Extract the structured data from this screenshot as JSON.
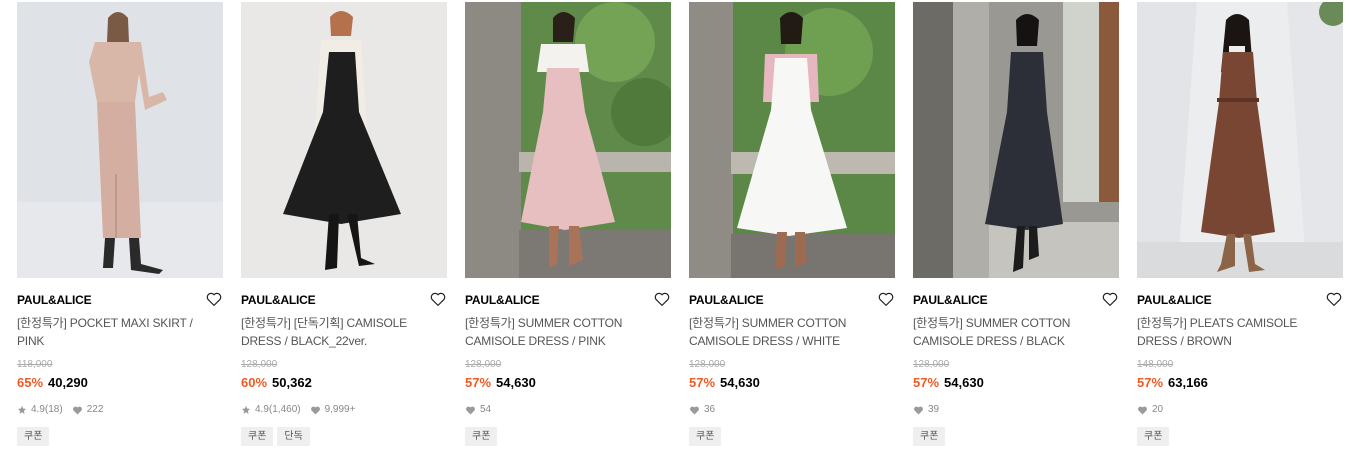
{
  "products": [
    {
      "brand": "PAUL&ALICE",
      "title": "[한정특가] POCKET MAXI SKIRT / PINK",
      "original_price": "118,000",
      "discount": "65%",
      "price": "40,290",
      "rating": "4.9",
      "reviews": "(18)",
      "likes": "222",
      "tags": [
        "쿠폰"
      ]
    },
    {
      "brand": "PAUL&ALICE",
      "title": "[한정특가] [단독기획] CAMISOLE DRESS / BLACK_22ver.",
      "original_price": "128,000",
      "discount": "60%",
      "price": "50,362",
      "rating": "4.9",
      "reviews": "(1,460)",
      "likes": "9,999+",
      "tags": [
        "쿠폰",
        "단독"
      ]
    },
    {
      "brand": "PAUL&ALICE",
      "title": "[한정특가] SUMMER COTTON CAMISOLE DRESS / PINK",
      "original_price": "128,000",
      "discount": "57%",
      "price": "54,630",
      "likes": "54",
      "tags": [
        "쿠폰"
      ]
    },
    {
      "brand": "PAUL&ALICE",
      "title": "[한정특가] SUMMER COTTON CAMISOLE DRESS / WHITE",
      "original_price": "128,000",
      "discount": "57%",
      "price": "54,630",
      "likes": "36",
      "tags": [
        "쿠폰"
      ]
    },
    {
      "brand": "PAUL&ALICE",
      "title": "[한정특가] SUMMER COTTON CAMISOLE DRESS / BLACK",
      "original_price": "128,000",
      "discount": "57%",
      "price": "54,630",
      "likes": "39",
      "tags": [
        "쿠폰"
      ]
    },
    {
      "brand": "PAUL&ALICE",
      "title": "[한정특가] PLEATS CAMISOLE DRESS / BROWN",
      "original_price": "148,000",
      "discount": "57%",
      "price": "63,166",
      "likes": "20",
      "tags": [
        "쿠폰"
      ]
    }
  ],
  "colors": {
    "discount": "#f05a23",
    "muted": "#888888",
    "tag_bg": "#efefef"
  },
  "icons": {
    "wishlist": "heart-outline-icon",
    "rating": "star-icon",
    "likes": "heart-filled-icon"
  }
}
